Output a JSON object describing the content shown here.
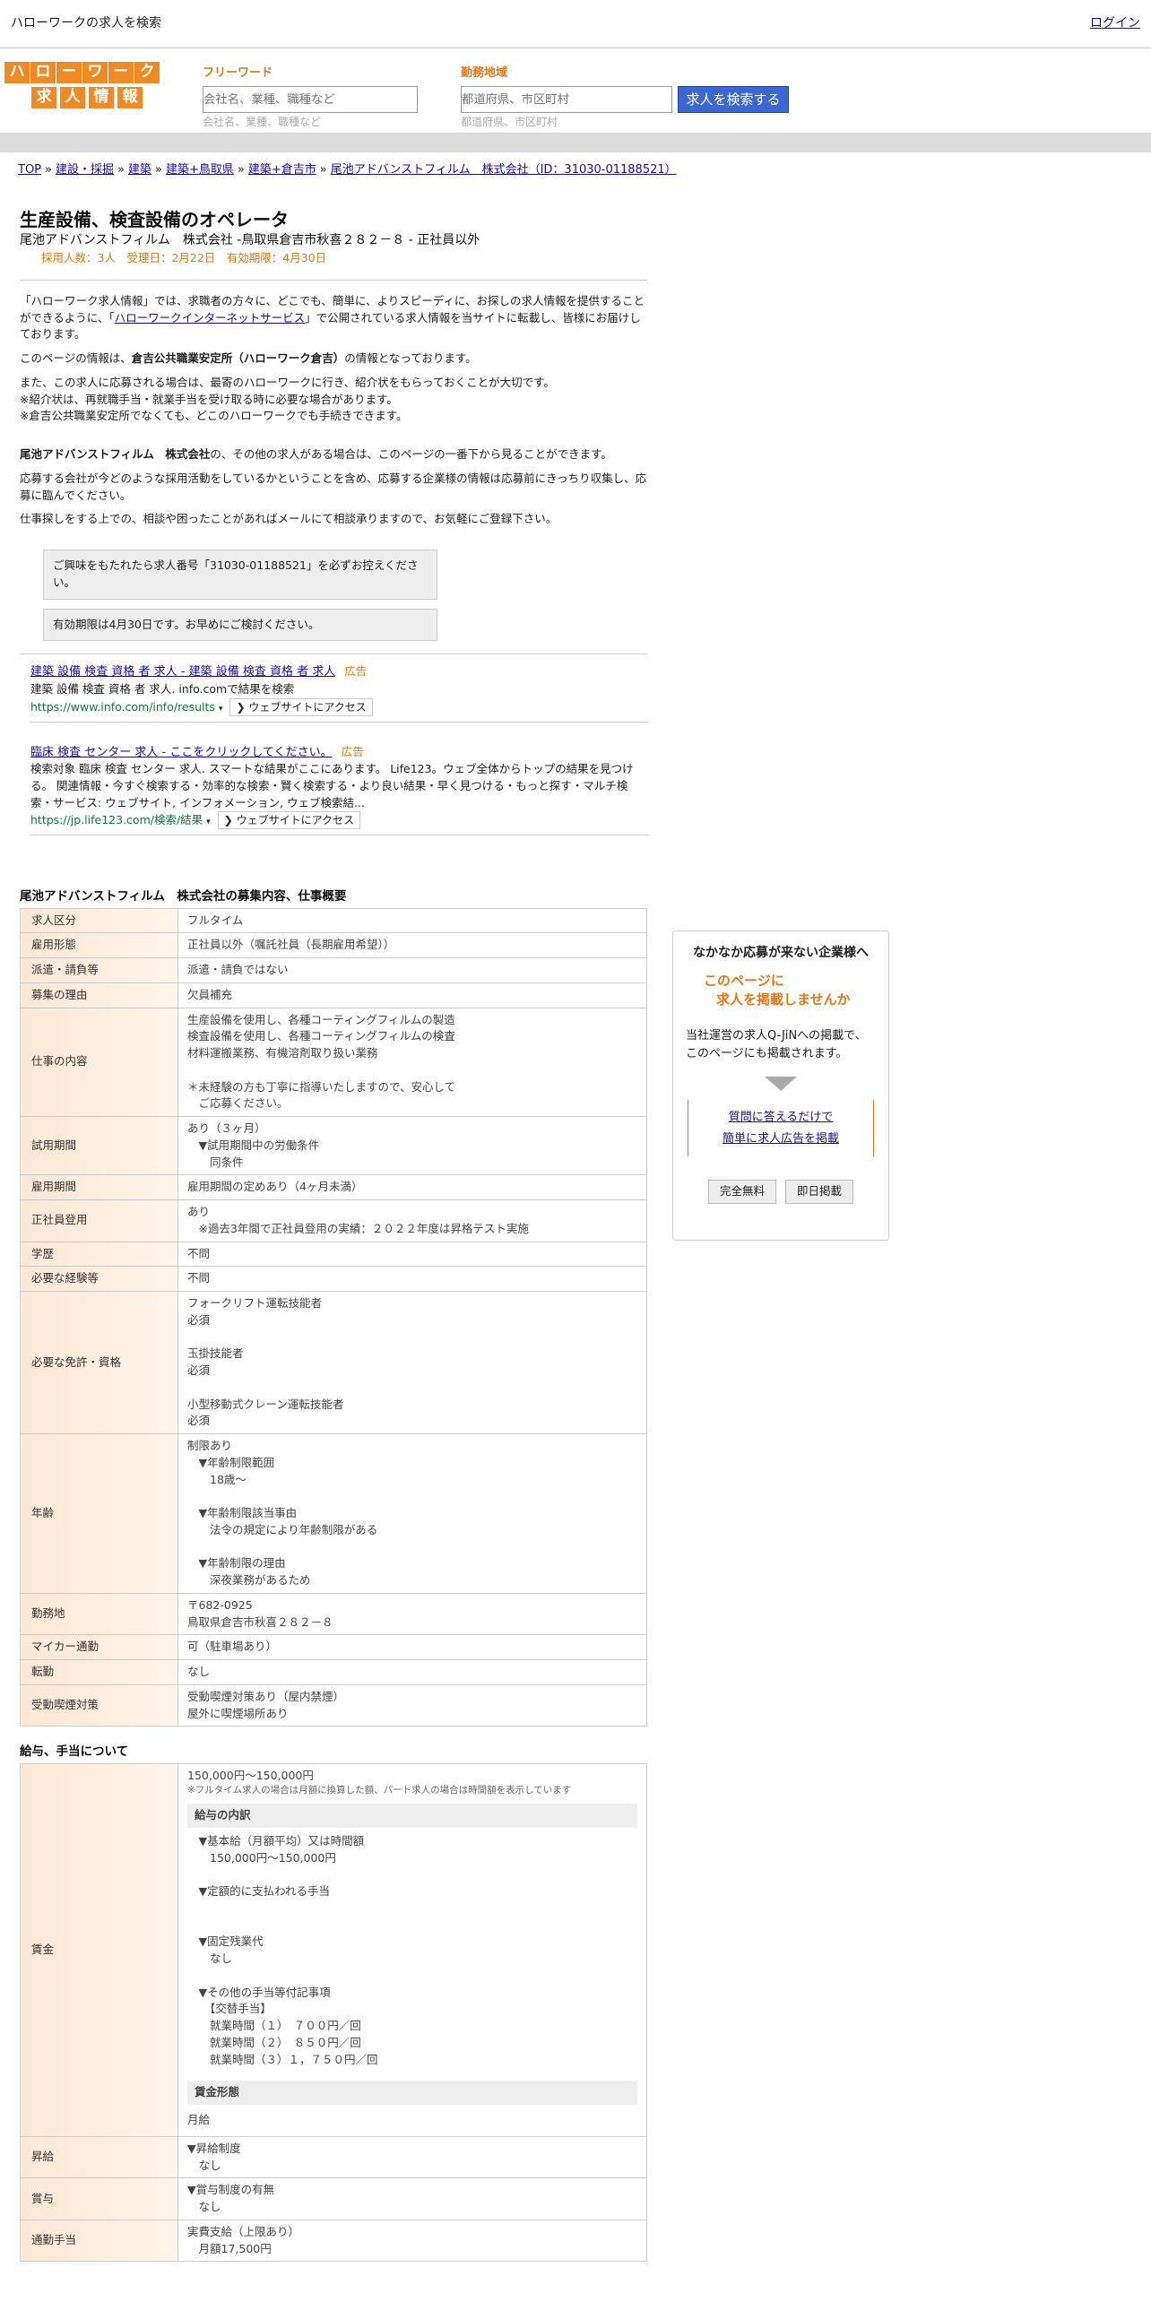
{
  "topbar": {
    "title": "ハローワークの求人を検索",
    "login": "ログイン"
  },
  "logo": {
    "row1": [
      "ハ",
      "ロ",
      "ー",
      "ワ",
      "ー",
      "ク"
    ],
    "row2": [
      "求",
      "人",
      "情",
      "報"
    ]
  },
  "search": {
    "freeword_label": "フリーワード",
    "freeword_placeholder": "会社名、業種、職種など",
    "area_label": "勤務地域",
    "area_placeholder": "都道府県、市区町村",
    "button": "求人を検索する"
  },
  "breadcrumb": [
    "TOP",
    "建設・採掘",
    "建築",
    "建築+鳥取県",
    "建築+倉吉市",
    "尾池アドバンストフィルム　株式会社（ID：31030-01188521）"
  ],
  "job": {
    "title": "生産設備、検査設備のオペレータ",
    "company_line": "尾池アドバンストフィルム　株式会社 -鳥取県倉吉市秋喜２８２－８ - 正社員以外",
    "meta": "採用人数：3人　受理日：2月22日　有効期限：4月30日"
  },
  "intro": {
    "p1a": "「ハローワーク求人情報」では、求職者の方々に、どこでも、簡単に、よりスピーディに、お探しの求人情報を提供することができるように、「",
    "p1link": "ハローワークインターネットサービス",
    "p1b": "」で公開されている求人情報を当サイトに転載し、皆様にお届けしております。",
    "p2a": "このページの情報は、",
    "p2b": "倉吉公共職業安定所（ハローワーク倉吉）",
    "p2c": "の情報となっております。",
    "p3": "また、この求人に応募される場合は、最寄のハローワークに行き、紹介状をもらっておくことが大切です。\n※紹介状は、再就職手当・就業手当を受け取る時に必要な場合があります。\n※倉吉公共職業安定所でなくても、どこのハローワークでも手続きできます。",
    "p4a": "尾池アドバンストフィルム　株式会社",
    "p4b": "の、その他の求人がある場合は、このページの一番下から見ることができます。",
    "p5": "応募する会社が今どのような採用活動をしているかということを含め、応募する企業様の情報は応募前にきっちり収集し、応募に臨んでください。",
    "p6": "仕事探しをする上での、相談や困ったことがあればメールにて相談承りますので、お気軽にご登録下さい。"
  },
  "notes": [
    "ご興味をもたれたら求人番号「31030-01188521」を必ずお控えください。",
    "有効期限は4月30日です。お早めにご検討ください。"
  ],
  "ads": [
    {
      "title": "建築 設備 検査 資格 者 求人 - 建築 設備 検査 資格 者 求人",
      "badge": "広告",
      "desc": "建築 設備 検査 資格 者 求人. info.comで結果を検索",
      "url": "https://www.info.com/info/results",
      "visit": "❯ ウェブサイトにアクセス"
    },
    {
      "title": "臨床 検査 センター 求人 - ここをクリックしてください。",
      "badge": "広告",
      "desc": "検索対象 臨床 検査 センター 求人. スマートな結果がここにあります。 Life123。ウェブ全体からトップの結果を見つける。 関連情報・今すぐ検索する・効率的な検索・賢く検索する・より良い結果・早く見つける・もっと探す・マルチ検索・サービス: ウェブサイト, インフォメーション, ウェブ検索結...",
      "url": "https://jp.life123.com/検索/結果",
      "visit": "❯ ウェブサイトにアクセス"
    }
  ],
  "details_title": "尾池アドバンストフィルム　株式会社の募集内容、仕事概要",
  "details": [
    {
      "k": "求人区分",
      "v": "フルタイム"
    },
    {
      "k": "雇用形態",
      "v": "正社員以外（嘱託社員（長期雇用希望））"
    },
    {
      "k": "派遣・請負等",
      "v": "派遣・請負ではない"
    },
    {
      "k": "募集の理由",
      "v": "欠員補充"
    },
    {
      "k": "仕事の内容",
      "v": "生産設備を使用し、各種コーティングフィルムの製造\n検査設備を使用し、各種コーティングフィルムの検査\n材料運搬業務、有機溶剤取り扱い業務\n\n＊未経験の方も丁寧に指導いたしますので、安心して\n　ご応募ください。"
    },
    {
      "k": "試用期間",
      "v": "あり（３ヶ月）\n　▼試用期間中の労働条件\n　　同条件"
    },
    {
      "k": "雇用期間",
      "v": "雇用期間の定めあり（4ヶ月未満）"
    },
    {
      "k": "正社員登用",
      "v": "あり\n　※過去3年間で正社員登用の実績：２０２２年度は昇格テスト実施"
    },
    {
      "k": "学歴",
      "v": "不問"
    },
    {
      "k": "必要な経験等",
      "v": "不問"
    },
    {
      "k": "必要な免許・資格",
      "v": "フォークリフト運転技能者\n必須\n\n玉掛技能者\n必須\n\n小型移動式クレーン運転技能者\n必須"
    },
    {
      "k": "年齢",
      "v": "制限あり\n　▼年齢制限範囲\n　　18歳〜\n\n　▼年齢制限該当事由\n　　法令の規定により年齢制限がある\n\n　▼年齢制限の理由\n　　深夜業務があるため"
    },
    {
      "k": "勤務地",
      "v": "〒682-0925\n鳥取県倉吉市秋喜２８２－８"
    },
    {
      "k": "マイカー通勤",
      "v": "可（駐車場あり）"
    },
    {
      "k": "転勤",
      "v": "なし"
    },
    {
      "k": "受動喫煙対策",
      "v": "受動喫煙対策あり（屋内禁煙）\n屋外に喫煙場所あり"
    }
  ],
  "salary_title": "給与、手当について",
  "salary": {
    "amount": "150,000円〜150,000円",
    "note": "※フルタイム求人の場合は月額に換算した額、パート求人の場合は時間額を表示しています",
    "breakdown_title": "給与の内訳",
    "breakdown": "　▼基本給（月額平均）又は時間額\n　　150,000円〜150,000円\n\n　▼定額的に支払われる手当\n\n\n　▼固定残業代\n　　なし\n\n　▼その他の手当等付記事項\n　　【交替手当】\n　　就業時間（１）　７００円／回\n　　就業時間（２）　８５０円／回\n　　就業時間（３）１，７５０円／回",
    "form_title": "賃金形態",
    "form": "月給"
  },
  "salary_rows": [
    {
      "k": "昇給",
      "v": "▼昇給制度\n　なし"
    },
    {
      "k": "賞与",
      "v": "▼賞与制度の有無\n　なし"
    },
    {
      "k": "通勤手当",
      "v": "実費支給（上限あり）\n　月額17,500円"
    }
  ],
  "side": {
    "heading": "なかなか応募が来ない企業様へ",
    "offer1": "このページに",
    "offer2": "求人を掲載しませんか",
    "desc": "当社運営の求人Q-JiNへの掲載で、このページにも掲載されます。",
    "link1": "質問に答えるだけで",
    "link2": "簡単に求人広告を掲載",
    "btn1": "完全無料",
    "btn2": "即日掲載"
  }
}
